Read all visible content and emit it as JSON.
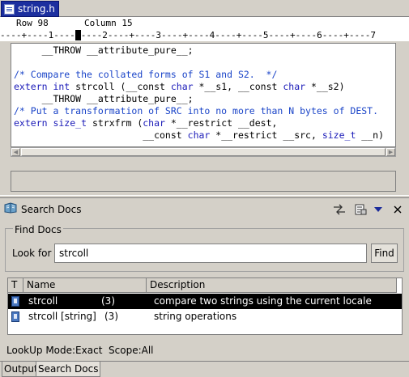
{
  "editor": {
    "tab_label": "string.h",
    "status": {
      "row": "Row 98",
      "column": "Column 15"
    },
    "ruler": "----+----1----",
    "ruler_after": "----2----+----3----+----4----+----5----+----6----+----7",
    "code_lines": [
      {
        "parts": [
          {
            "t": "     __THROW __attribute_pure__;",
            "c": "plain"
          }
        ]
      },
      {
        "parts": [
          {
            "t": "",
            "c": "plain"
          }
        ]
      },
      {
        "parts": [
          {
            "t": "/* Compare the collated forms of S1 and S2.  */",
            "c": "cm"
          }
        ]
      },
      {
        "parts": [
          {
            "t": "extern int ",
            "c": "kw"
          },
          {
            "t": "strcoll (__const ",
            "c": "plain"
          },
          {
            "t": "char",
            "c": "kw"
          },
          {
            "t": " *__s1, __const ",
            "c": "plain"
          },
          {
            "t": "char",
            "c": "kw"
          },
          {
            "t": " *__s2)",
            "c": "plain"
          }
        ]
      },
      {
        "parts": [
          {
            "t": "     __THROW __attribute_pure__;",
            "c": "plain"
          }
        ]
      },
      {
        "parts": [
          {
            "t": "/* Put a transformation of SRC into no more than N bytes of DEST.",
            "c": "cm"
          }
        ]
      },
      {
        "parts": [
          {
            "t": "extern size_t ",
            "c": "kw"
          },
          {
            "t": "strxfrm (",
            "c": "plain"
          },
          {
            "t": "char",
            "c": "kw"
          },
          {
            "t": " *__restrict __dest,",
            "c": "plain"
          }
        ]
      },
      {
        "parts": [
          {
            "t": "                       __const ",
            "c": "plain"
          },
          {
            "t": "char",
            "c": "kw"
          },
          {
            "t": " *__restrict __src, ",
            "c": "plain"
          },
          {
            "t": "size_t",
            "c": "kw"
          },
          {
            "t": " __n)",
            "c": "plain"
          }
        ]
      }
    ]
  },
  "search_docs": {
    "title": "Search Docs",
    "icons": [
      "book-icon",
      "sync-icon",
      "properties-icon",
      "dropdown-icon",
      "close-icon"
    ],
    "group_label": "Find Docs",
    "look_for_label": "Look for",
    "search_value": "strcoll",
    "find_button": "Find",
    "columns": [
      "T",
      "Name",
      "Description"
    ],
    "rows": [
      {
        "name": "strcoll",
        "section": "(3)",
        "description": "compare two strings using the current locale",
        "selected": true
      },
      {
        "name": "strcoll [string]",
        "section": "(3)",
        "description": "string operations",
        "selected": false
      }
    ],
    "status": "LookUp Mode:Exact  Scope:All"
  },
  "bottom_tabs": [
    "Output",
    "Search Docs"
  ],
  "colors": {
    "tab_active": "#1c2f9f",
    "comment": "#1a44c8",
    "keyword": "#1a1ab8",
    "selection": "#000000"
  }
}
